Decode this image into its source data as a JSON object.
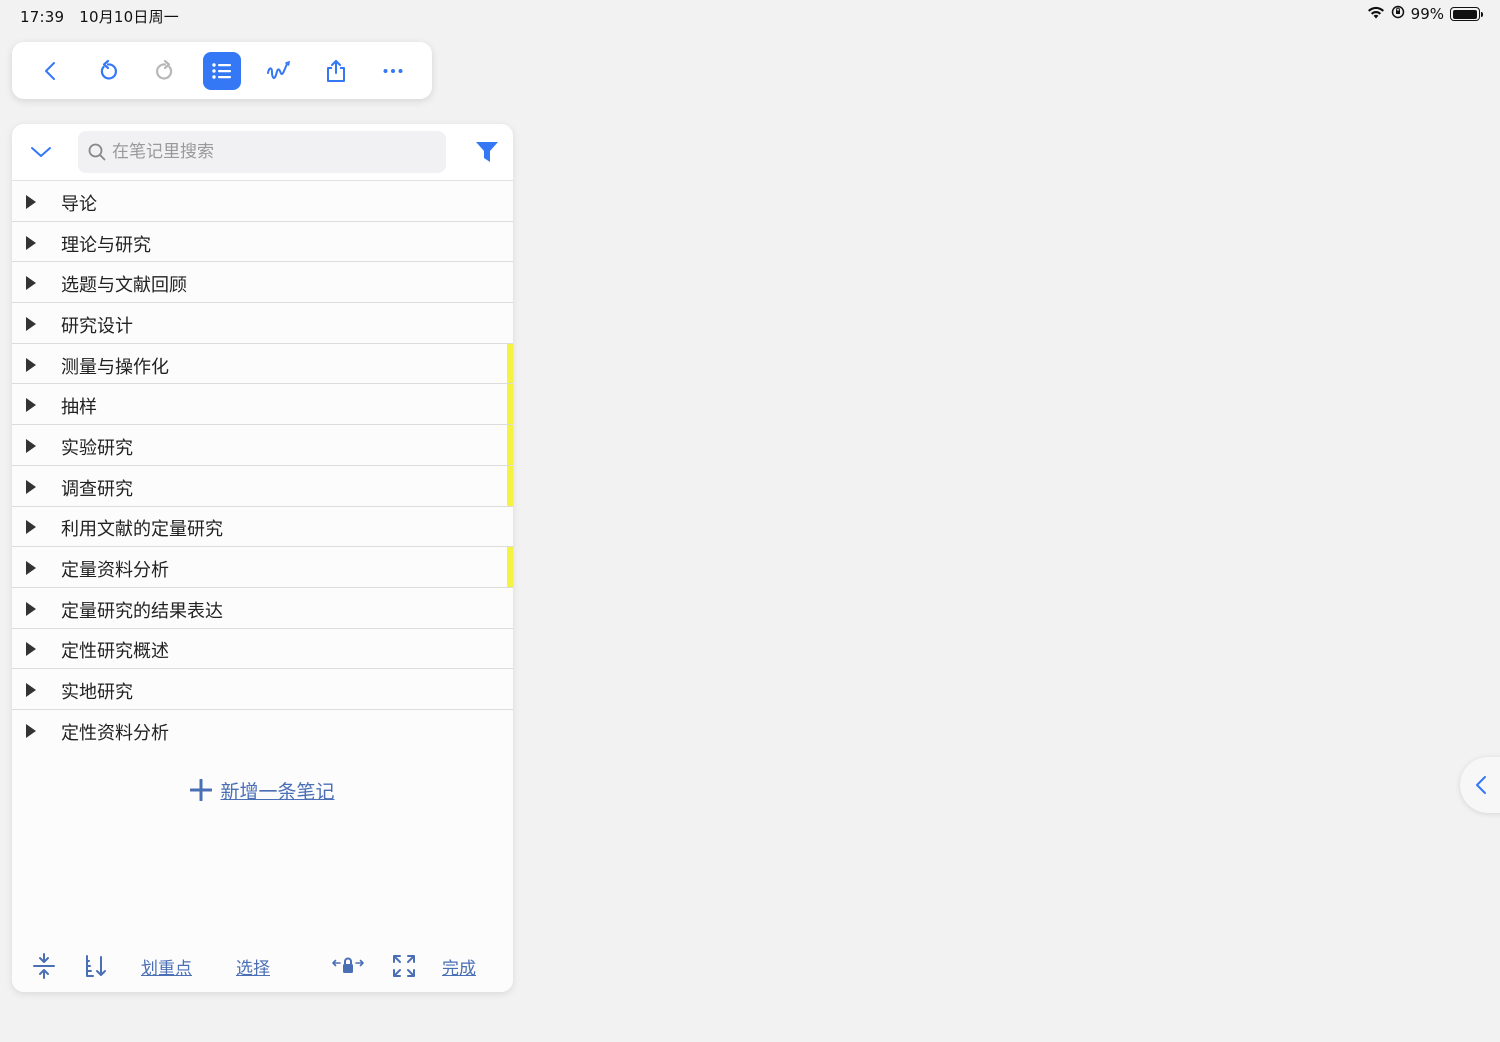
{
  "status_bar": {
    "time": "17:39",
    "date": "10月10日周一",
    "battery": "99%"
  },
  "toolbar": {
    "buttons": [
      "back-icon",
      "undo-icon",
      "redo-icon",
      "outline-list-icon",
      "handwriting-icon",
      "share-icon",
      "more-icon"
    ],
    "active": "outline-list-icon",
    "accent": "#3478f6"
  },
  "notes_panel": {
    "search_placeholder": "在笔记里搜索",
    "items": [
      {
        "label": "导论",
        "highlight": false
      },
      {
        "label": "理论与研究",
        "highlight": false
      },
      {
        "label": "选题与文献回顾",
        "highlight": false
      },
      {
        "label": "研究设计",
        "highlight": false
      },
      {
        "label": "测量与操作化",
        "highlight": true
      },
      {
        "label": "抽样",
        "highlight": true
      },
      {
        "label": "实验研究",
        "highlight": true
      },
      {
        "label": "调查研究",
        "highlight": true
      },
      {
        "label": "利用文献的定量研究",
        "highlight": false
      },
      {
        "label": "定量资料分析",
        "highlight": true
      },
      {
        "label": "定量研究的结果表达",
        "highlight": false
      },
      {
        "label": "定性研究概述",
        "highlight": false
      },
      {
        "label": "实地研究",
        "highlight": false
      },
      {
        "label": "定性资料分析",
        "highlight": false
      }
    ],
    "add_note_label": "新增一条笔记",
    "highlight_color": "#f5f242",
    "link_color": "#4a6fb5"
  },
  "footer": {
    "highlight_label": "划重点",
    "select_label": "选择",
    "done_label": "完成"
  }
}
